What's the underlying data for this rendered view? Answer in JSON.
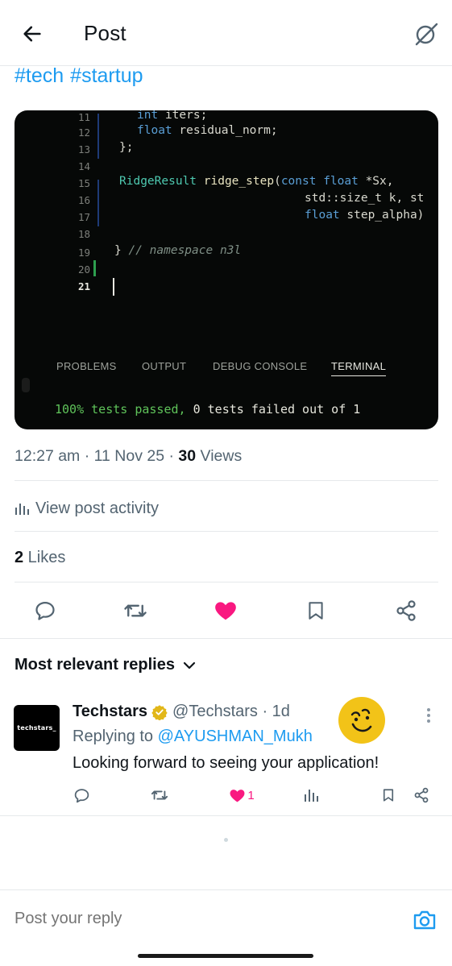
{
  "header": {
    "title": "Post",
    "back_icon": "arrow-left-icon",
    "grok_icon": "grok-slash-icon"
  },
  "post": {
    "hashtags": [
      "#tech",
      "#startup"
    ],
    "media": {
      "code_lines": [
        {
          "num": "11",
          "text": "int iters;"
        },
        {
          "num": "12",
          "text": "float residual_norm;"
        },
        {
          "num": "13",
          "text": "};"
        },
        {
          "num": "14",
          "text": ""
        },
        {
          "num": "15",
          "text": "RidgeResult ridge_step(const float *Sx,"
        },
        {
          "num": "16",
          "text": "std::size_t k, st"
        },
        {
          "num": "17",
          "text": "float step_alpha)"
        },
        {
          "num": "18",
          "text": ""
        },
        {
          "num": "19",
          "text": "} // namespace n3l"
        },
        {
          "num": "20",
          "text": ""
        },
        {
          "num": "21",
          "text": ""
        }
      ],
      "panel_tabs": [
        "PROBLEMS",
        "OUTPUT",
        "DEBUG CONSOLE",
        "TERMINAL"
      ],
      "selected_tab": "TERMINAL",
      "terminal_pass": "100% tests passed,",
      "terminal_rest": " 0 tests failed out of 1"
    },
    "meta": {
      "time_date": "12:27 am · 11 Nov 25 · ",
      "views_count": "30",
      "views_label": " Views"
    },
    "activity_label": "View post activity",
    "likes": {
      "count": "2",
      "label": " Likes"
    },
    "liked": true,
    "accent_color": "#1d9bf0",
    "like_color": "#f91880"
  },
  "replies_header": "Most relevant replies",
  "reply": {
    "avatar_text": "techstars_",
    "name": "Techstars",
    "handle_time": "@Techstars · 1d",
    "replying_prefix": "Replying to ",
    "replying_to": "@AYUSHMAN_Mukh",
    "text": "Looking forward to seeing your application!",
    "like_count": "1"
  },
  "composer": {
    "placeholder": "Post your reply"
  }
}
